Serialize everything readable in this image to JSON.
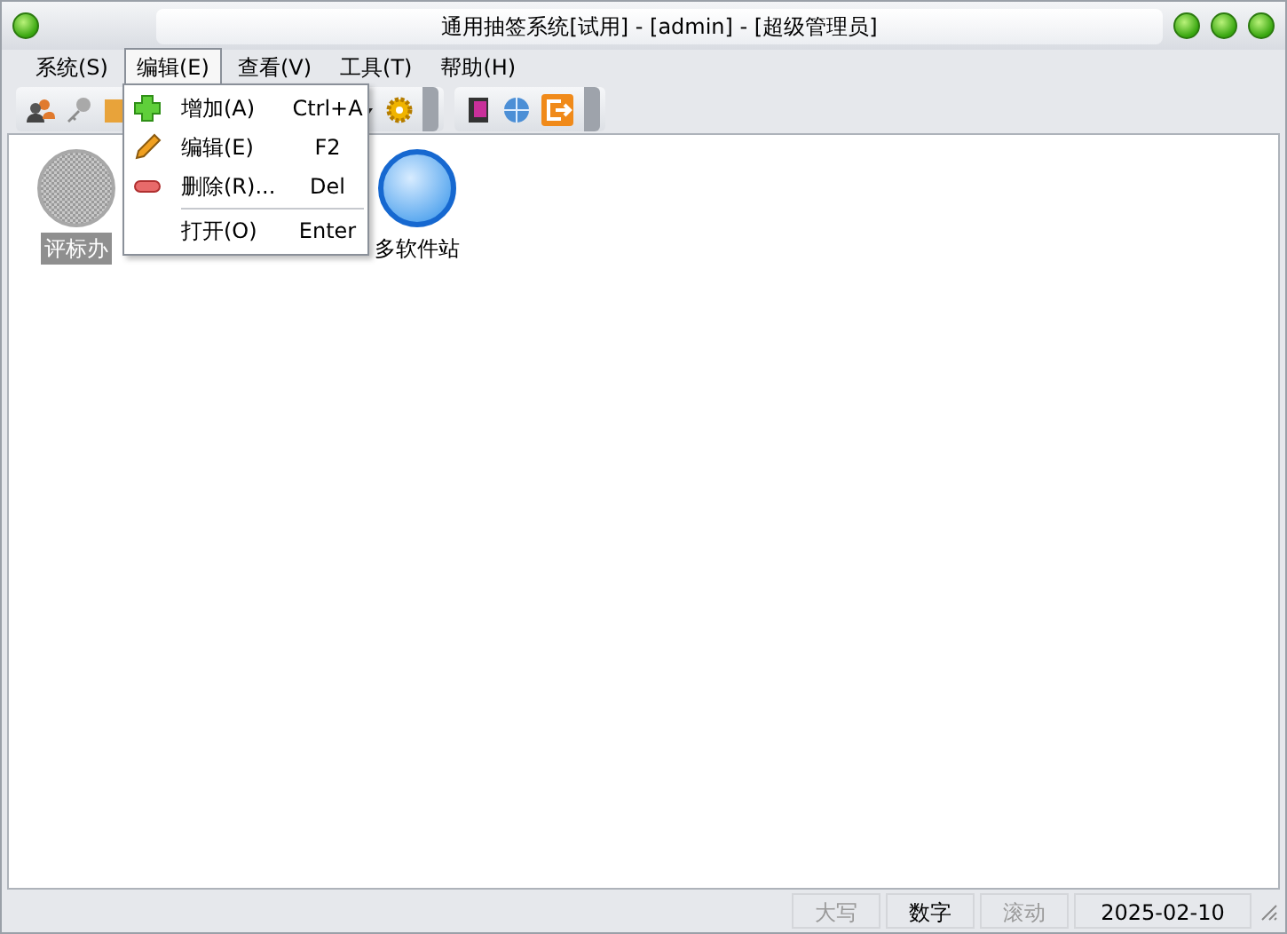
{
  "window": {
    "title": "通用抽签系统[试用]  - [admin] - [超级管理员]"
  },
  "menu": [
    {
      "label": "系统(S)",
      "selected": false
    },
    {
      "label": "编辑(E)",
      "selected": true
    },
    {
      "label": "查看(V)",
      "selected": false
    },
    {
      "label": "工具(T)",
      "selected": false
    },
    {
      "label": "帮助(H)",
      "selected": false
    }
  ],
  "dropdown": [
    {
      "kind": "item",
      "label": "增加(A)",
      "shortcut": "Ctrl+A"
    },
    {
      "kind": "item",
      "label": "编辑(E)",
      "shortcut": "F2"
    },
    {
      "kind": "item",
      "label": "删除(R)...",
      "shortcut": "Del"
    },
    {
      "kind": "separator"
    },
    {
      "kind": "item",
      "label": "打开(O)",
      "shortcut": "Enter"
    }
  ],
  "desktop": [
    {
      "label": "评标办",
      "selected": true
    },
    {
      "label": "多软件站",
      "selected": false
    }
  ],
  "status_bar": {
    "indicators": [
      {
        "text": "大写",
        "on": false
      },
      {
        "text": "数字",
        "on": true
      },
      {
        "text": "滚动",
        "on": false
      }
    ],
    "date": "2025-02-10"
  }
}
